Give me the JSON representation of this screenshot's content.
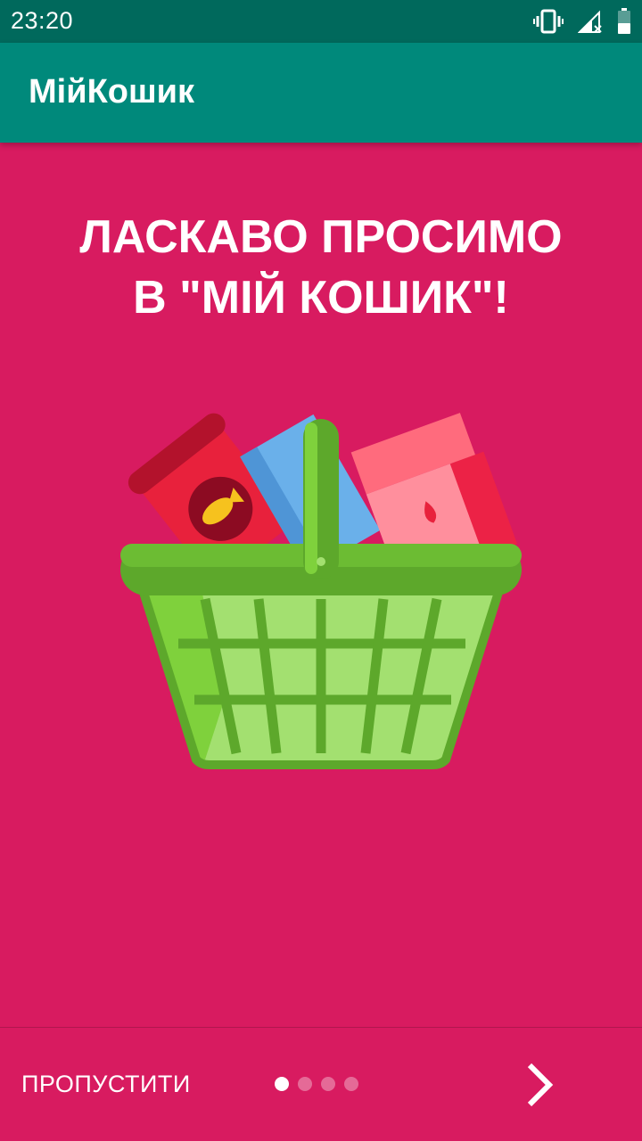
{
  "status_bar": {
    "time": "23:20",
    "icons": [
      "vibrate-icon",
      "signal-icon",
      "battery-icon"
    ]
  },
  "app_bar": {
    "title": "МійКошик"
  },
  "welcome": {
    "line1": "ЛАСКАВО ПРОСИМО",
    "line2": "В \"МІЙ КОШИК\"!"
  },
  "illustration": {
    "icon": "shopping-basket-icon"
  },
  "bottom_bar": {
    "skip_label": "ПРОПУСТИТИ",
    "page_indicator": {
      "total": 4,
      "current": 1
    },
    "next_icon": "chevron-right-icon"
  },
  "colors": {
    "status_bar": "#00695c",
    "app_bar": "#00897b",
    "background": "#d81b60",
    "basket_green": "#6ab030"
  }
}
